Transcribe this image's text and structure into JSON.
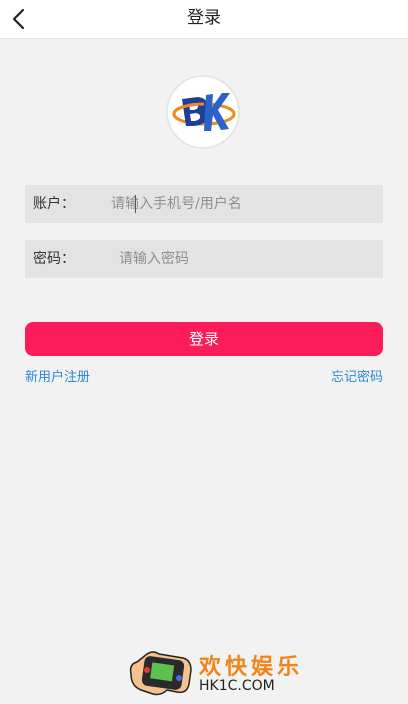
{
  "header": {
    "title": "登录",
    "back_icon": "chevron-left-icon"
  },
  "logo": {
    "icon": "bk-logo"
  },
  "form": {
    "account": {
      "label": "账户：",
      "placeholder": "请输入手机号/用户名",
      "value": ""
    },
    "password": {
      "label": "密码：",
      "placeholder": "请输入密码",
      "value": ""
    },
    "login_label": "登录"
  },
  "links": {
    "register": "新用户注册",
    "forgot": "忘记密码"
  },
  "watermark": {
    "title": "欢快娱乐",
    "url": "HK1C.COM"
  },
  "colors": {
    "accent": "#fb1c59",
    "link": "#2a86d8",
    "background": "#f2f2f2",
    "field_bg": "#e3e3e3"
  }
}
